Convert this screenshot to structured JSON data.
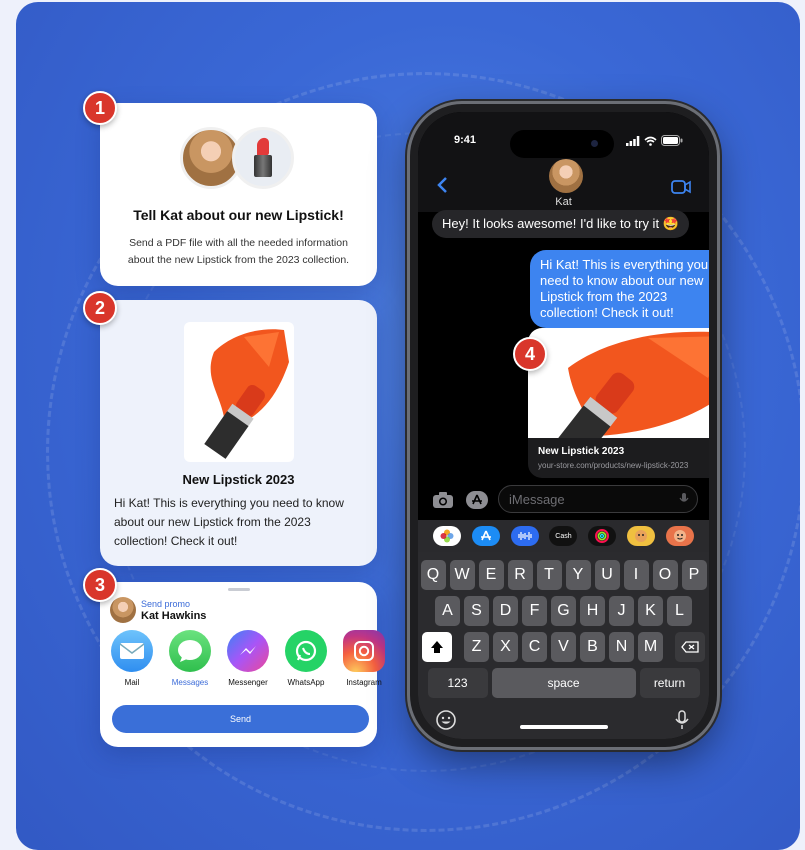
{
  "badges": [
    "1",
    "2",
    "3",
    "4"
  ],
  "card1": {
    "title": "Tell Kat about our new Lipstick!",
    "description": "Send a PDF file with all the needed information about the new Lipstick from the 2023 collection."
  },
  "card2": {
    "product_title": "New Lipstick 2023",
    "message": "Hi Kat! This is everything you need to know about our new Lipstick from the 2023 collection! Check it out!"
  },
  "share_sheet": {
    "promo_label": "Send promo",
    "contact_name": "Kat Hawkins",
    "apps": [
      {
        "label": "Mail",
        "icon": "mail-icon",
        "color": "#4aa3f5"
      },
      {
        "label": "Messages",
        "icon": "messages-icon",
        "color": "#34c759"
      },
      {
        "label": "Messenger",
        "icon": "messenger-icon",
        "color": "#8f5cf6"
      },
      {
        "label": "WhatsApp",
        "icon": "whatsapp-icon",
        "color": "#25d366"
      },
      {
        "label": "Instagram",
        "icon": "instagram-icon",
        "color": "#e1306c"
      }
    ],
    "send_label": "Send"
  },
  "phone": {
    "time": "9:41",
    "contact_name": "Kat",
    "incoming_message": "Hey! It looks awesome! I'd like to try it 🤩",
    "outgoing_message": "Hi Kat! This is everything you need to know about our new Lipstick from the 2023 collection! Check it out!",
    "link_title": "New Lipstick 2023",
    "link_url": "your-store.com/products/new-lipstick-2023",
    "input_placeholder": "iMessage",
    "tray_cash_label": "Cash",
    "keyboard": {
      "row1": [
        "Q",
        "W",
        "E",
        "R",
        "T",
        "Y",
        "U",
        "I",
        "O",
        "P"
      ],
      "row2": [
        "A",
        "S",
        "D",
        "F",
        "G",
        "H",
        "J",
        "K",
        "L"
      ],
      "row3": [
        "Z",
        "X",
        "C",
        "V",
        "B",
        "N",
        "M"
      ],
      "numbers_label": "123",
      "space_label": "space",
      "return_label": "return"
    }
  },
  "colors": {
    "background": "#3a68d6",
    "badge": "#d9362b",
    "accent": "#3a6fd8",
    "imessage_blue": "#3d84f0"
  }
}
